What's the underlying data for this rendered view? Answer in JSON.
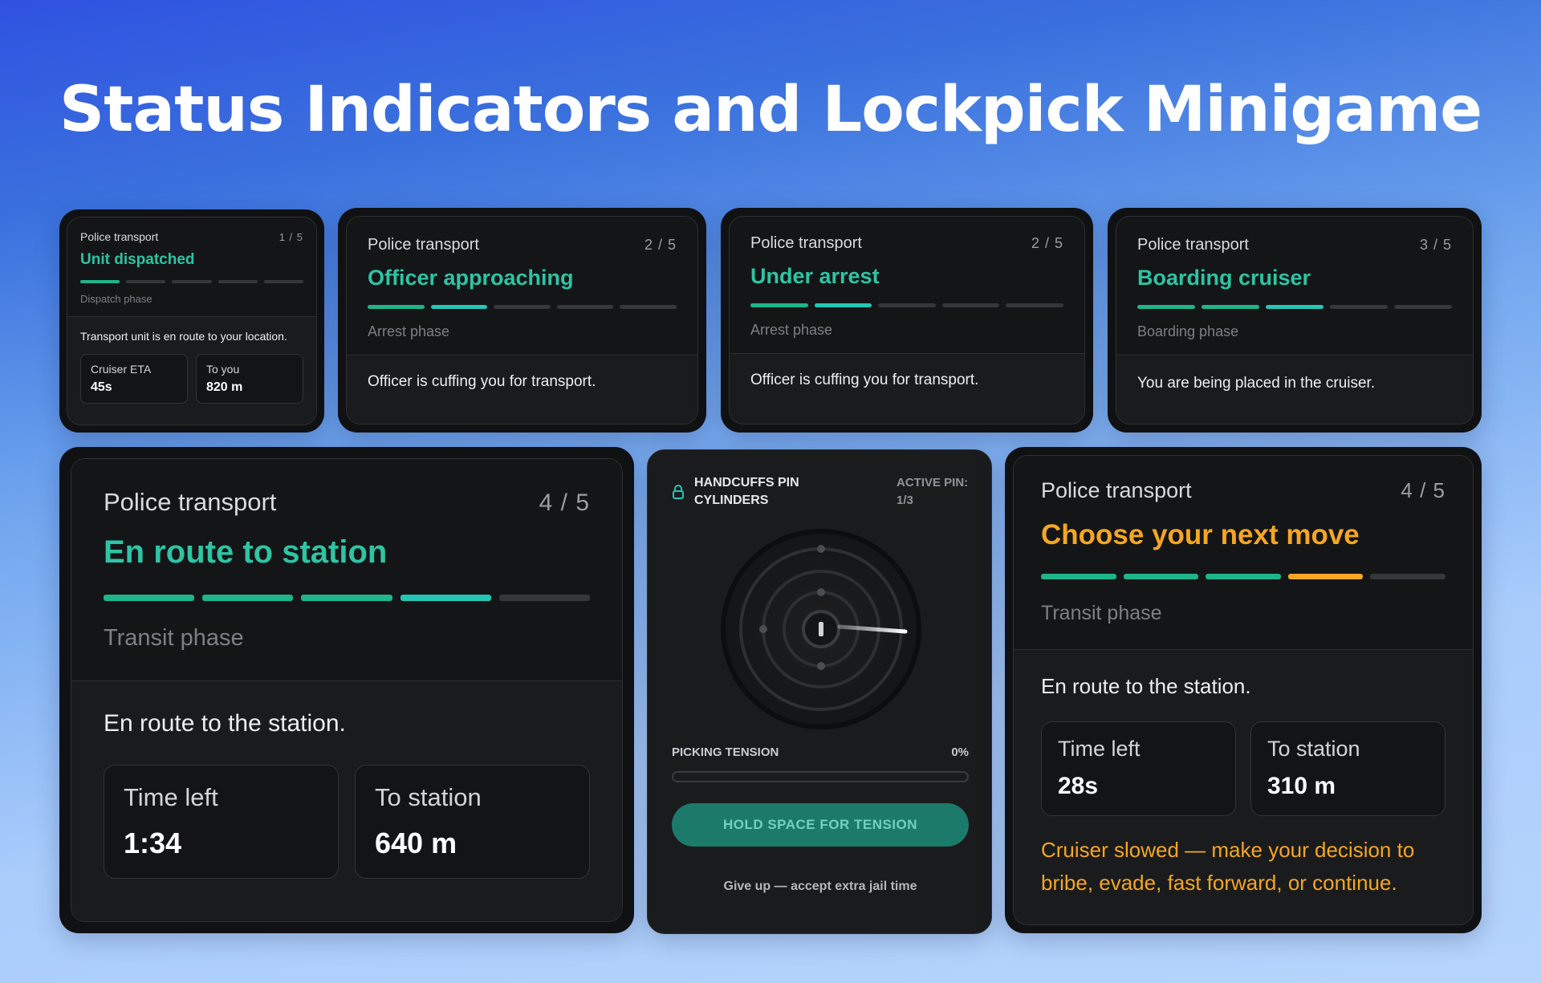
{
  "headline": "Status Indicators and Lockpick Minigame",
  "cards": [
    {
      "label": "Police transport",
      "step": "1 / 5",
      "status": "Unit dispatched",
      "phase": "Dispatch phase",
      "message": "Transport unit is en route to your location.",
      "tiles": [
        {
          "label": "Cruiser ETA",
          "value": "45s"
        },
        {
          "label": "To you",
          "value": "820 m"
        }
      ]
    },
    {
      "label": "Police transport",
      "step": "2 / 5",
      "status": "Officer approaching",
      "phase": "Arrest phase",
      "message": "Officer is cuffing you for transport."
    },
    {
      "label": "Police transport",
      "step": "2 / 5",
      "status": "Under arrest",
      "phase": "Arrest phase",
      "message": "Officer is cuffing you for transport."
    },
    {
      "label": "Police transport",
      "step": "3 / 5",
      "status": "Boarding cruiser",
      "phase": "Boarding phase",
      "message": "You are being placed in the cruiser."
    },
    {
      "label": "Police transport",
      "step": "4 / 5",
      "status": "En route to station",
      "phase": "Transit phase",
      "message": "En route to the station.",
      "tiles": [
        {
          "label": "Time left",
          "value": "1:34"
        },
        {
          "label": "To station",
          "value": "640 m"
        }
      ]
    },
    {
      "label": "Police transport",
      "step": "4 / 5",
      "status": "Choose your next move",
      "phase": "Transit phase",
      "message": "En route to the station.",
      "tiles": [
        {
          "label": "Time left",
          "value": "28s"
        },
        {
          "label": "To station",
          "value": "310 m"
        }
      ],
      "warning": "Cruiser slowed — make your decision to bribe, evade, fast forward, or continue."
    }
  ],
  "lockpick": {
    "title_line1": "HANDCUFFS PIN",
    "title_line2": "CYLINDERS",
    "active_label": "ACTIVE PIN:",
    "active_value": "1/3",
    "tension_label": "PICKING TENSION",
    "tension_value": "0%",
    "tension_fraction": 0,
    "button": "HOLD SPACE FOR TENSION",
    "give_up": "Give up — accept extra jail time"
  },
  "colors": {
    "green": "#1eb58a",
    "teal": "#25c6b5",
    "orange": "#f5a623",
    "empty": "#35373a"
  }
}
